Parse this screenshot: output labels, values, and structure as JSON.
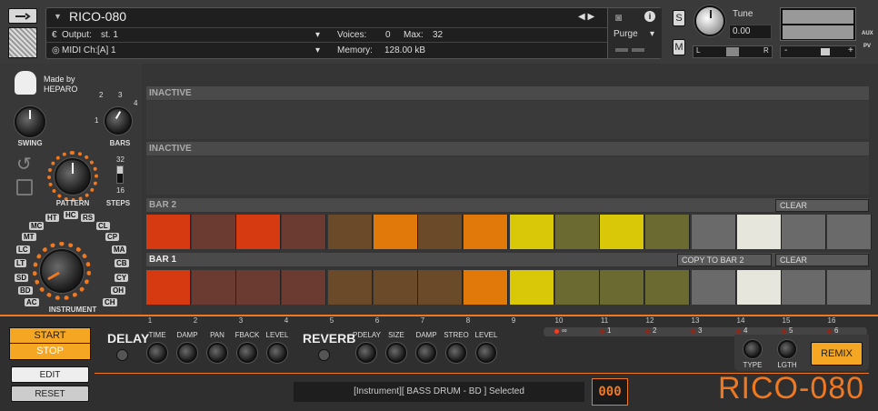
{
  "header": {
    "instrument_name": "RICO-080",
    "output_label": "Output:",
    "output_value": "st. 1",
    "voices_label": "Voices:",
    "voices_value": "0",
    "max_label": "Max:",
    "max_value": "32",
    "midi_label": "MIDI Ch:",
    "midi_value": "[A] 1",
    "memory_label": "Memory:",
    "memory_value": "128.00 kB",
    "purge_label": "Purge",
    "solo_label": "S",
    "mute_label": "M",
    "tune_label": "Tune",
    "tune_value": "0.00",
    "pan_left": "L",
    "pan_right": "R",
    "aux_label": "AUX",
    "pv_label": "PV",
    "minus": "-",
    "plus": "+"
  },
  "left": {
    "made_by": "Made by",
    "brand": "HEPARO",
    "swing_label": "SWING",
    "bars_label": "BARS",
    "pattern_label": "PATTERN",
    "steps_label": "STEPS",
    "bars_ticks": [
      "1",
      "2",
      "3",
      "4"
    ],
    "steps_top": "32",
    "steps_bottom": "16",
    "instrument_label": "INSTRUMENT",
    "instruments": [
      "AC",
      "BD",
      "SD",
      "LT",
      "LC",
      "MT",
      "MC",
      "HT",
      "HC",
      "RS",
      "CL",
      "CP",
      "MA",
      "CB",
      "CY",
      "OH",
      "CH"
    ]
  },
  "sequencer": {
    "rows": [
      {
        "title": "INACTIVE"
      },
      {
        "title": "INACTIVE"
      },
      {
        "title": "BAR 2",
        "clear": "CLEAR",
        "cells": [
          "#d63a10",
          "#6b3a30",
          "#d63a10",
          "#6b3a30",
          "#6b4a2a",
          "#e0780a",
          "#6b4a2a",
          "#e0780a",
          "#d8c808",
          "#6b6a30",
          "#d8c808",
          "#6b6a30",
          "#6a6a6a",
          "#e6e6dc",
          "#6a6a6a",
          "#6a6a6a"
        ]
      },
      {
        "title": "BAR 1",
        "copy": "COPY TO BAR 2",
        "clear": "CLEAR",
        "cells": [
          "#d63a10",
          "#6b3a30",
          "#6b3a30",
          "#6b3a30",
          "#6b4a2a",
          "#6b4a2a",
          "#6b4a2a",
          "#e0780a",
          "#d8c808",
          "#6b6a30",
          "#6b6a30",
          "#6b6a30",
          "#6a6a6a",
          "#e6e6dc",
          "#6a6a6a",
          "#6a6a6a"
        ]
      }
    ],
    "step_numbers": [
      "1",
      "2",
      "3",
      "4",
      "5",
      "6",
      "7",
      "8",
      "9",
      "10",
      "11",
      "12",
      "13",
      "14",
      "15",
      "16"
    ]
  },
  "bottom": {
    "start_label": "START",
    "stop_label": "STOP",
    "edit_label": "EDIT",
    "reset_label": "RESET",
    "delay_label": "DELAY",
    "delay_knobs": [
      "TIME",
      "DAMP",
      "PAN",
      "FBACK",
      "LEVEL"
    ],
    "reverb_label": "REVERB",
    "reverb_knobs": [
      "PDELAY",
      "SIZE",
      "DAMP",
      "STREO",
      "LEVEL"
    ],
    "remix_options": [
      "∞",
      "1",
      "2",
      "3",
      "4",
      "5",
      "6"
    ],
    "type_label": "TYPE",
    "lgth_label": "LGTH",
    "remix_label": "REMIX",
    "status": "[Instrument][ BASS DRUM - BD ] Selected",
    "counter": "000",
    "logo": "RICO-080"
  },
  "colors": {
    "accent": "#f07820",
    "orange_button": "#f5a623"
  }
}
